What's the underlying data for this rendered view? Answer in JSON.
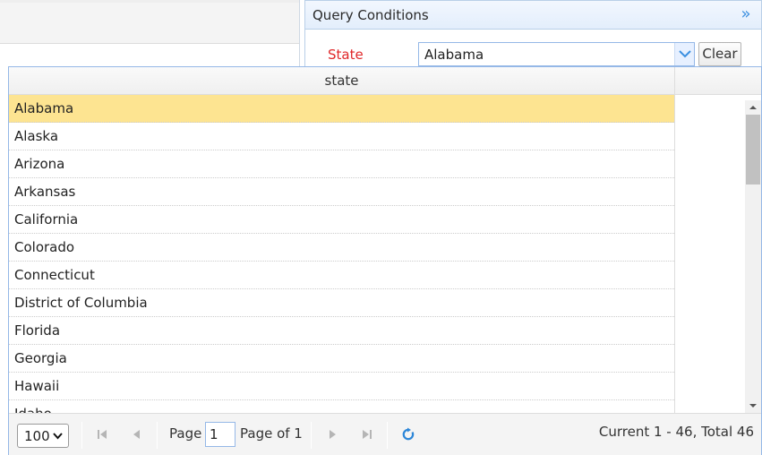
{
  "query_panel": {
    "title": "Query Conditions",
    "collapse_icon": "double-chevron-right-icon",
    "state_label": "State",
    "state_value": "Alabama",
    "clear_label": "Clear"
  },
  "dropdown": {
    "column_header": "state",
    "rows": [
      "Alabama",
      "Alaska",
      "Arizona",
      "Arkansas",
      "California",
      "Colorado",
      "Connecticut",
      "District of Columbia",
      "Florida",
      "Georgia",
      "Hawaii",
      "Idaho"
    ],
    "selected_index": 0
  },
  "pager": {
    "page_size": "100",
    "page_label": "Page",
    "page_value": "1",
    "page_of": "Page of 1",
    "info": "Current 1 - 46, Total 46"
  },
  "colors": {
    "selected_row": "#fde491",
    "required_label": "#e0282a",
    "accent": "#3a8fe0"
  }
}
